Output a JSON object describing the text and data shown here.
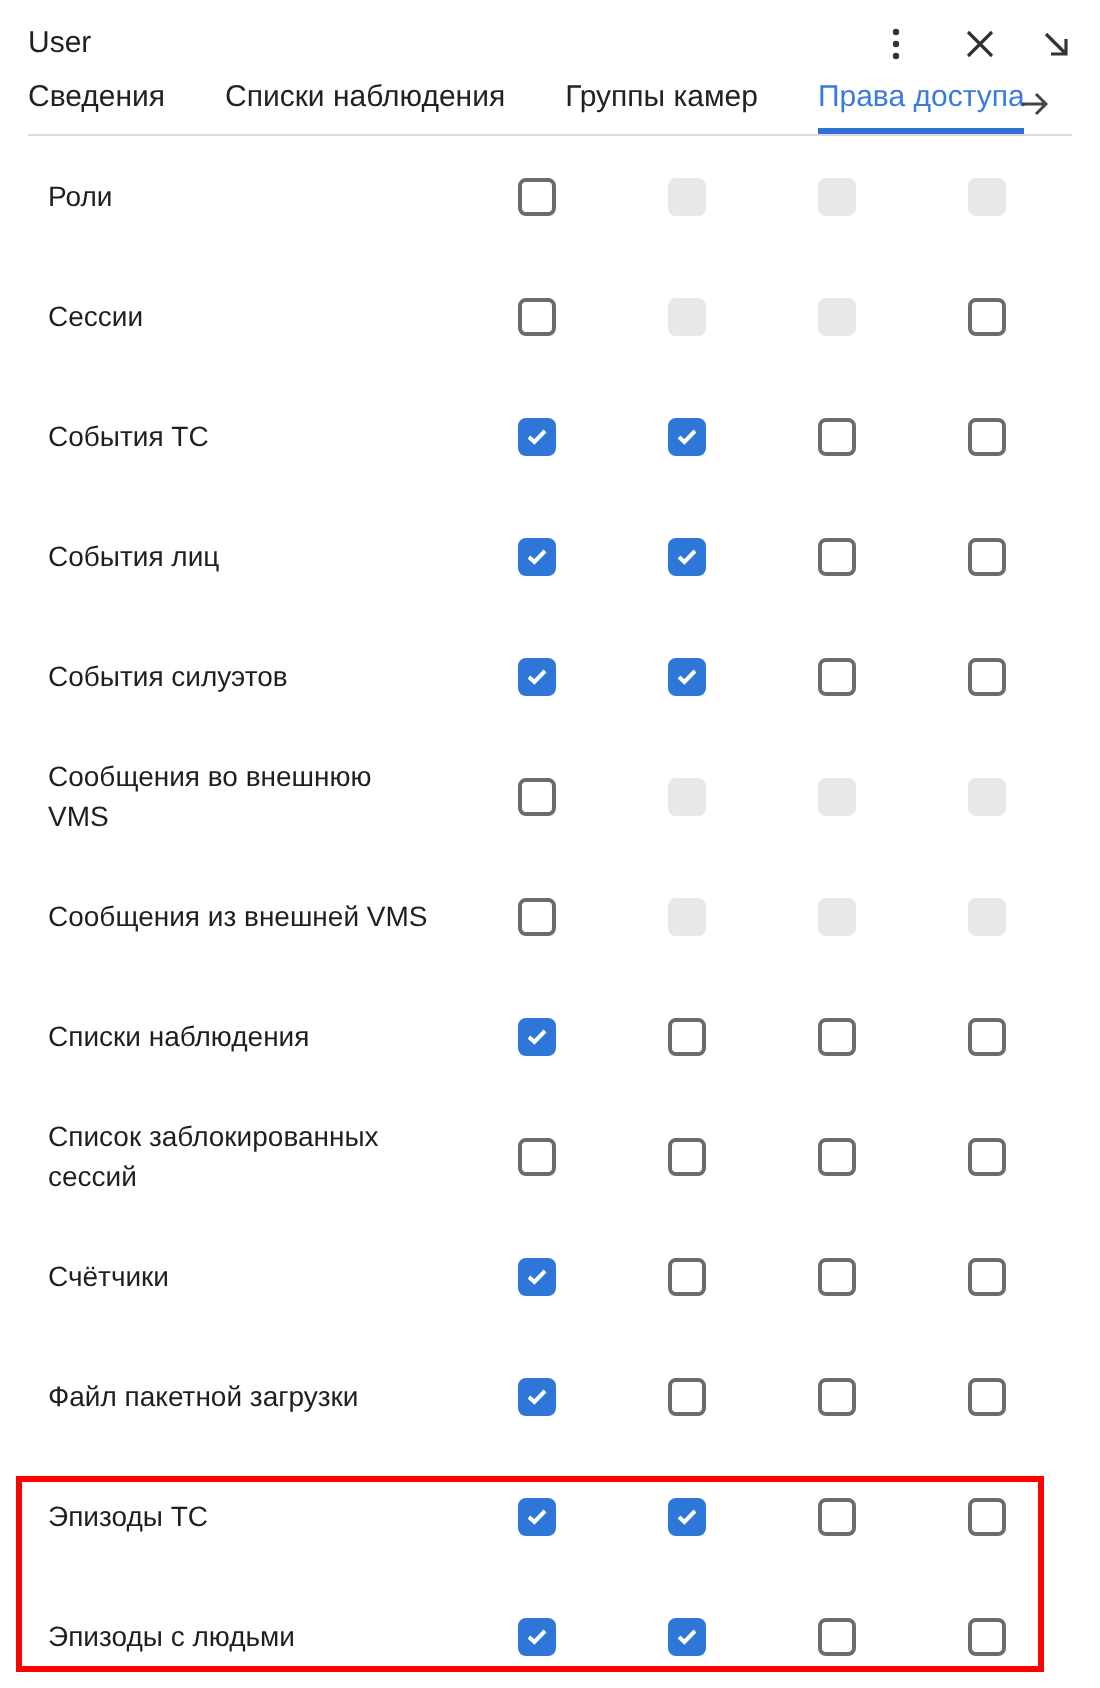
{
  "window": {
    "title": "User"
  },
  "tabs": [
    {
      "label": "Сведения",
      "selected": false
    },
    {
      "label": "Списки наблюдения",
      "selected": false
    },
    {
      "label": "Группы камер",
      "selected": false
    },
    {
      "label": "Права доступа",
      "selected": true
    }
  ],
  "rows": [
    {
      "label": "Роли",
      "highlighted": false,
      "cells": [
        {
          "checked": false,
          "disabled": false
        },
        {
          "checked": false,
          "disabled": true
        },
        {
          "checked": false,
          "disabled": true
        },
        {
          "checked": false,
          "disabled": true
        }
      ]
    },
    {
      "label": "Сессии",
      "highlighted": false,
      "cells": [
        {
          "checked": false,
          "disabled": false
        },
        {
          "checked": false,
          "disabled": true
        },
        {
          "checked": false,
          "disabled": true
        },
        {
          "checked": false,
          "disabled": false
        }
      ]
    },
    {
      "label": "События ТС",
      "highlighted": false,
      "cells": [
        {
          "checked": true,
          "disabled": false
        },
        {
          "checked": true,
          "disabled": false
        },
        {
          "checked": false,
          "disabled": false
        },
        {
          "checked": false,
          "disabled": false
        }
      ]
    },
    {
      "label": "События лиц",
      "highlighted": false,
      "cells": [
        {
          "checked": true,
          "disabled": false
        },
        {
          "checked": true,
          "disabled": false
        },
        {
          "checked": false,
          "disabled": false
        },
        {
          "checked": false,
          "disabled": false
        }
      ]
    },
    {
      "label": "События силуэтов",
      "highlighted": false,
      "cells": [
        {
          "checked": true,
          "disabled": false
        },
        {
          "checked": true,
          "disabled": false
        },
        {
          "checked": false,
          "disabled": false
        },
        {
          "checked": false,
          "disabled": false
        }
      ]
    },
    {
      "label": "Сообщения во внешнюю VMS",
      "highlighted": false,
      "cells": [
        {
          "checked": false,
          "disabled": false
        },
        {
          "checked": false,
          "disabled": true
        },
        {
          "checked": false,
          "disabled": true
        },
        {
          "checked": false,
          "disabled": true
        }
      ]
    },
    {
      "label": "Сообщения из внешней VMS",
      "highlighted": false,
      "cells": [
        {
          "checked": false,
          "disabled": false
        },
        {
          "checked": false,
          "disabled": true
        },
        {
          "checked": false,
          "disabled": true
        },
        {
          "checked": false,
          "disabled": true
        }
      ]
    },
    {
      "label": "Списки наблюдения",
      "highlighted": false,
      "cells": [
        {
          "checked": true,
          "disabled": false
        },
        {
          "checked": false,
          "disabled": false
        },
        {
          "checked": false,
          "disabled": false
        },
        {
          "checked": false,
          "disabled": false
        }
      ]
    },
    {
      "label": "Список заблокированных сессий",
      "highlighted": false,
      "cells": [
        {
          "checked": false,
          "disabled": false
        },
        {
          "checked": false,
          "disabled": false
        },
        {
          "checked": false,
          "disabled": false
        },
        {
          "checked": false,
          "disabled": false
        }
      ]
    },
    {
      "label": "Счётчики",
      "highlighted": false,
      "cells": [
        {
          "checked": true,
          "disabled": false
        },
        {
          "checked": false,
          "disabled": false
        },
        {
          "checked": false,
          "disabled": false
        },
        {
          "checked": false,
          "disabled": false
        }
      ]
    },
    {
      "label": "Файл пакетной загрузки",
      "highlighted": false,
      "cells": [
        {
          "checked": true,
          "disabled": false
        },
        {
          "checked": false,
          "disabled": false
        },
        {
          "checked": false,
          "disabled": false
        },
        {
          "checked": false,
          "disabled": false
        }
      ]
    },
    {
      "label": "Эпизоды ТС",
      "highlighted": true,
      "cells": [
        {
          "checked": true,
          "disabled": false
        },
        {
          "checked": true,
          "disabled": false
        },
        {
          "checked": false,
          "disabled": false
        },
        {
          "checked": false,
          "disabled": false
        }
      ]
    },
    {
      "label": "Эпизоды с людьми",
      "highlighted": true,
      "cells": [
        {
          "checked": true,
          "disabled": false
        },
        {
          "checked": true,
          "disabled": false
        },
        {
          "checked": false,
          "disabled": false
        },
        {
          "checked": false,
          "disabled": false
        }
      ]
    }
  ]
}
